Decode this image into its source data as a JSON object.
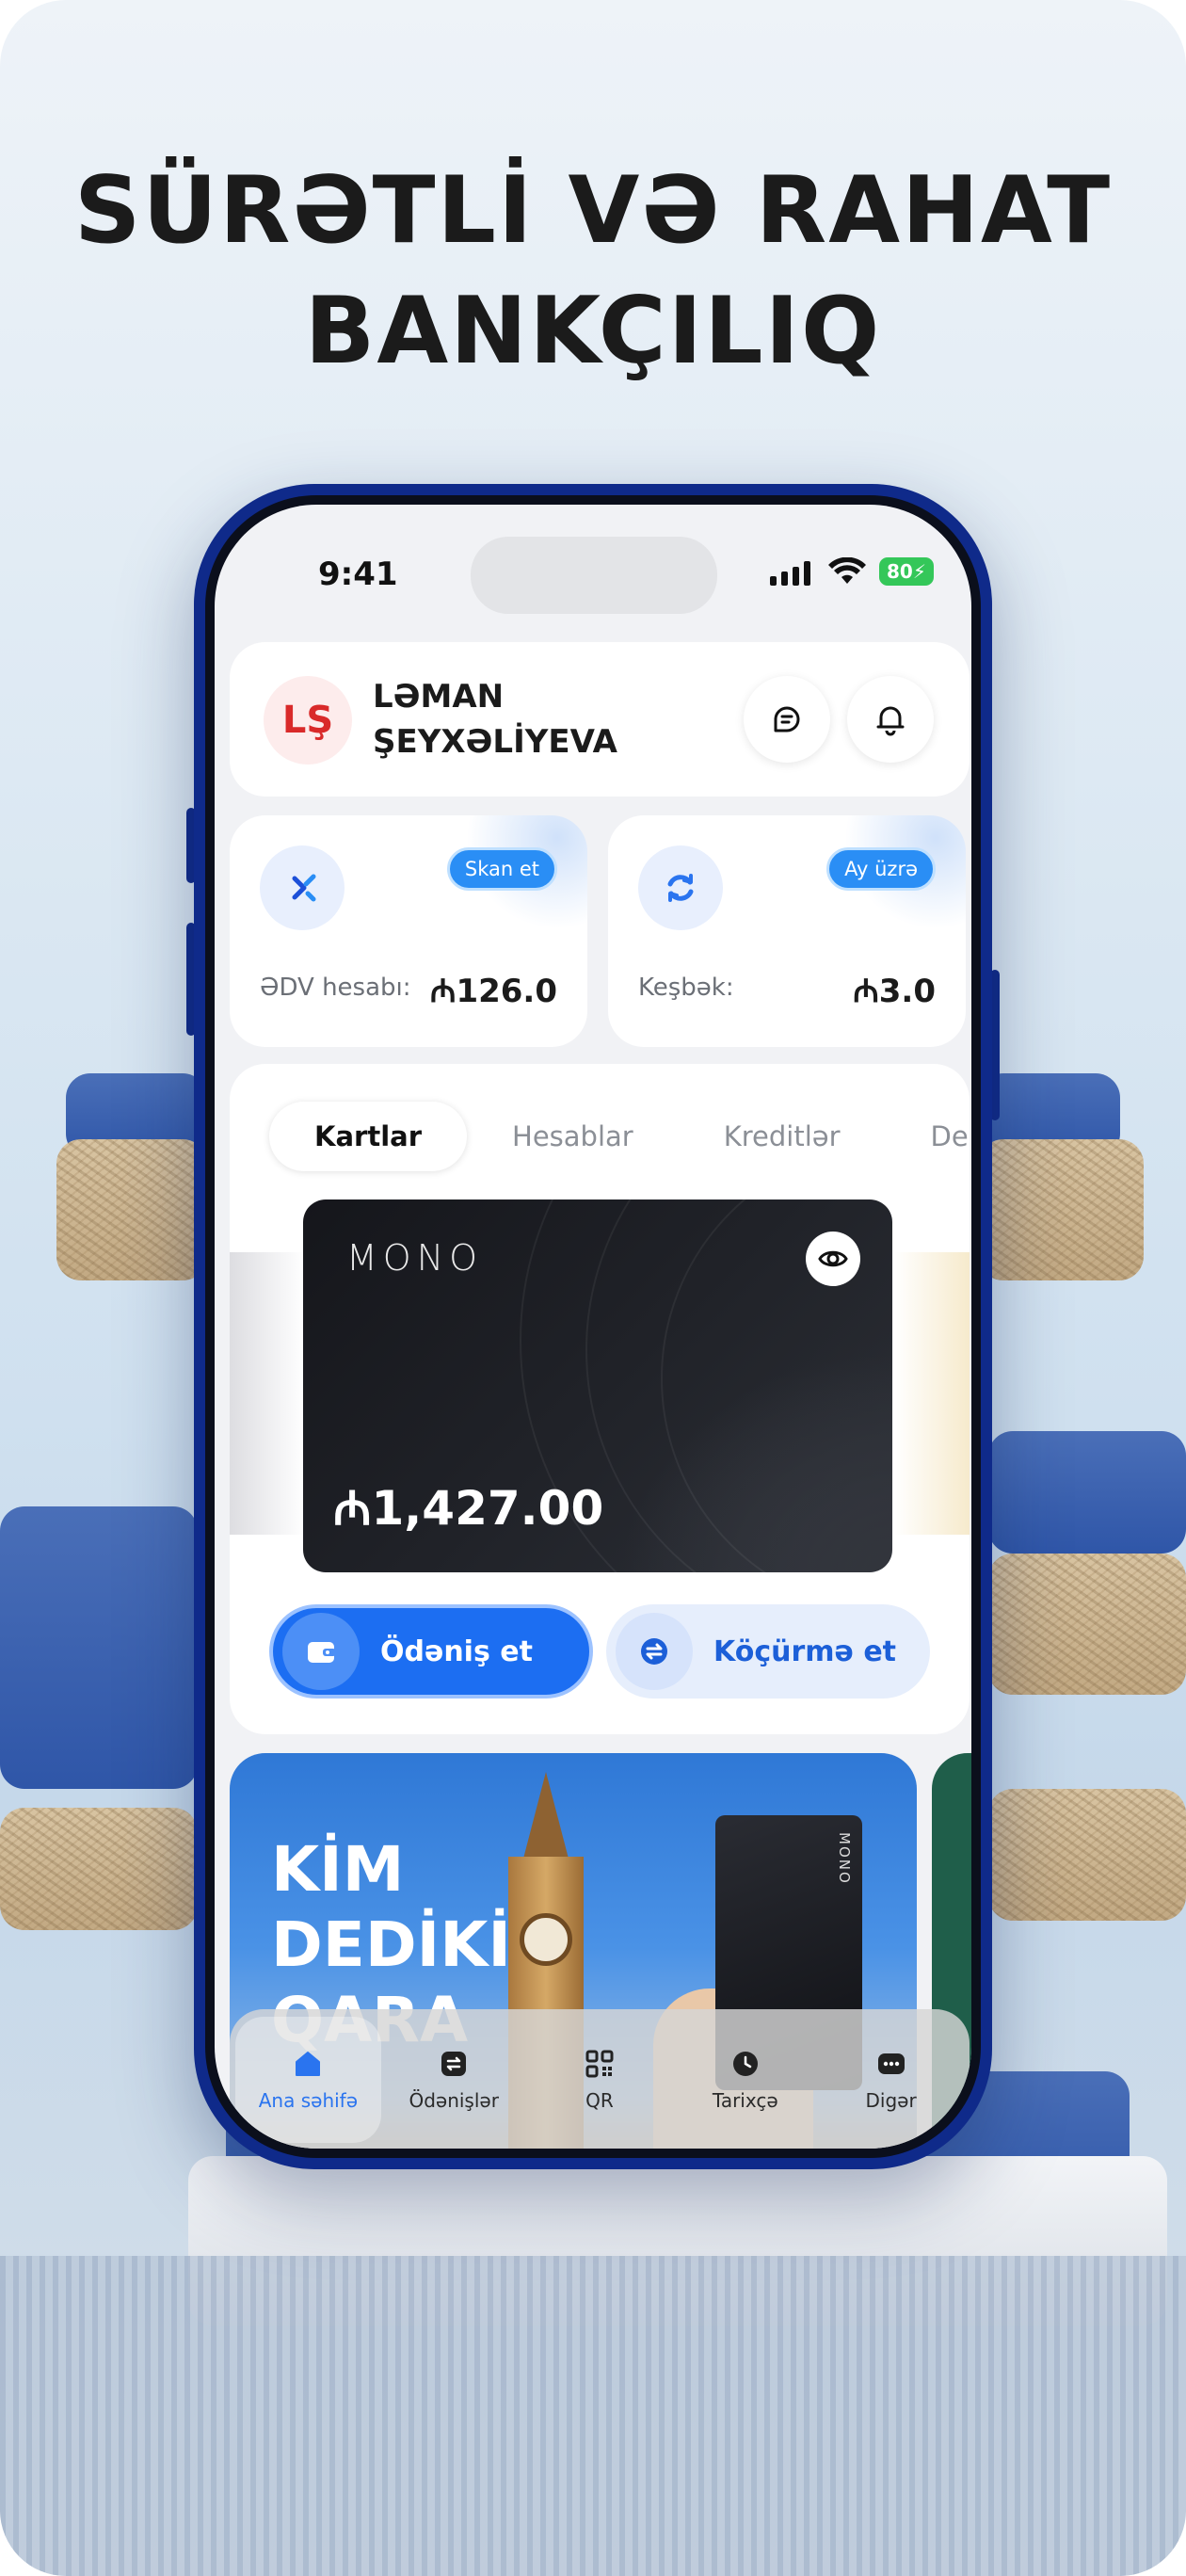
{
  "headline": {
    "line1": "SÜRƏTLİ VƏ RAHAT",
    "line2": "BANKÇILIQ"
  },
  "status_bar": {
    "time": "9:41",
    "battery": "80"
  },
  "profile": {
    "initials": "LŞ",
    "first_name": "LƏMAN",
    "last_name": "ŞEYXƏLİYEVA"
  },
  "widgets": [
    {
      "badge": "Skan et",
      "label": "ƏDV hesabı:",
      "value": "₼126.0",
      "icon": "transfer-arrows-icon"
    },
    {
      "badge": "Ay üzrə",
      "label": "Keşbək:",
      "value": "₼3.0",
      "icon": "refresh-icon"
    }
  ],
  "tabs": [
    "Kartlar",
    "Hesablar",
    "Kreditlər",
    "Depozitlər"
  ],
  "active_tab": "Kartlar",
  "card": {
    "brand": "MONO",
    "balance": "₼1,427.00"
  },
  "actions": {
    "pay": "Ödəniş et",
    "transfer": "Köçürmə et"
  },
  "promo": {
    "text_line1": "KİM",
    "text_line2": "DEDİKİ",
    "text_line3": "QARA",
    "card_brand": "MONO"
  },
  "bottom_nav": [
    {
      "label": "Ana səhifə",
      "icon": "home-icon",
      "active": true
    },
    {
      "label": "Ödənişlər",
      "icon": "payments-icon",
      "active": false
    },
    {
      "label": "QR",
      "icon": "qr-icon",
      "active": false
    },
    {
      "label": "Tarixçə",
      "icon": "clock-icon",
      "active": false
    },
    {
      "label": "Digər",
      "icon": "more-icon",
      "active": false
    }
  ],
  "colors": {
    "accent": "#1C6EF2",
    "badge": "#2A8EF5",
    "phone_frame": "#0F2A8A",
    "avatar_text": "#D92A2A"
  }
}
